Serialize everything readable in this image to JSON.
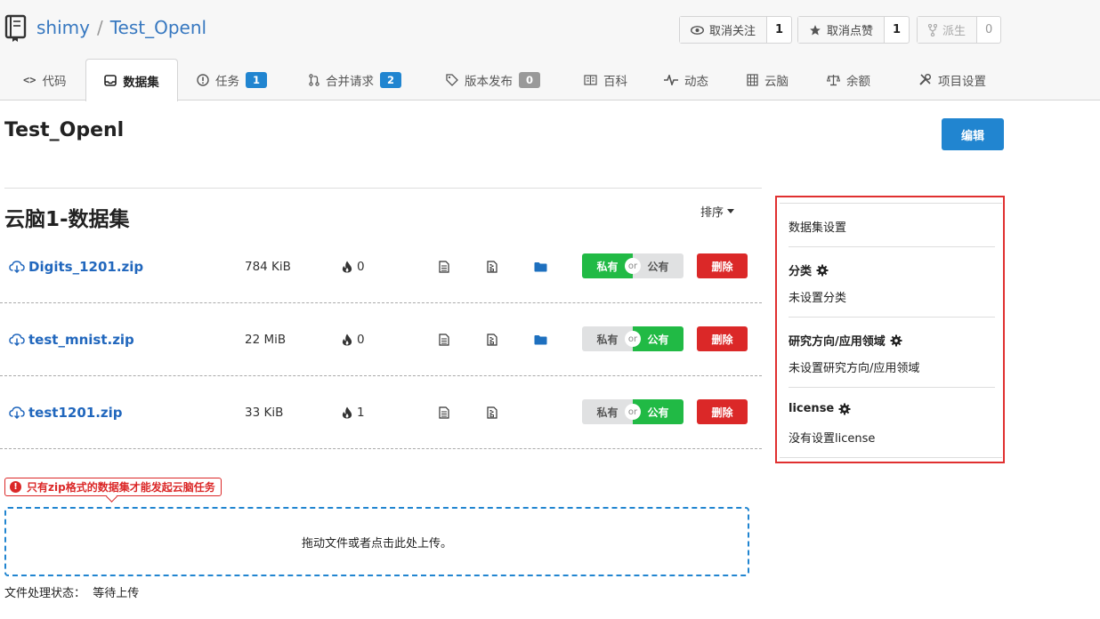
{
  "repo": {
    "owner": "shimy",
    "separator": "/",
    "name": "Test_Openl"
  },
  "actions": [
    {
      "label": "取消关注",
      "count": "1",
      "icon": "eye-icon"
    },
    {
      "label": "取消点赞",
      "count": "1",
      "icon": "star-icon"
    },
    {
      "label": "派生",
      "count": "0",
      "icon": "fork-icon",
      "disabled": true
    }
  ],
  "tabs": [
    {
      "label": "代码",
      "icon": "code-icon"
    },
    {
      "label": "数据集",
      "icon": "inbox-icon",
      "active": true
    },
    {
      "label": "任务",
      "icon": "info-circle-icon",
      "badge": "1"
    },
    {
      "label": "合并请求",
      "icon": "pull-request-icon",
      "badge": "2"
    },
    {
      "label": "版本发布",
      "icon": "tag-icon",
      "badge": "0"
    },
    {
      "label": "百科",
      "icon": "book-icon"
    },
    {
      "label": "动态",
      "icon": "pulse-icon"
    },
    {
      "label": "云脑",
      "icon": "server-icon"
    },
    {
      "label": "余额",
      "icon": "balance-scale-icon"
    },
    {
      "label": "项目设置",
      "icon": "tools-icon"
    }
  ],
  "page": {
    "title": "Test_Openl",
    "edit_label": "编辑"
  },
  "dataset": {
    "title": "云脑1-数据集",
    "sort_label": "排序",
    "files": [
      {
        "name": "Digits_1201.zip",
        "size": "784 KiB",
        "hot": "0",
        "folder": true,
        "public": false
      },
      {
        "name": "test_mnist.zip",
        "size": "22 MiB",
        "hot": "0",
        "folder": true,
        "public": true
      },
      {
        "name": "test1201.zip",
        "size": "33 KiB",
        "hot": "1",
        "folder": false,
        "public": true
      }
    ],
    "toggle": {
      "private": "私有",
      "or": "or",
      "public": "公有"
    },
    "delete_label": "删除"
  },
  "sidebar": {
    "settings_label": "数据集设置",
    "category": {
      "label": "分类",
      "value": "未设置分类"
    },
    "research": {
      "label": "研究方向/应用领域",
      "value": "未设置研究方向/应用领域"
    },
    "license": {
      "label": "license",
      "value": "没有设置license"
    }
  },
  "upload": {
    "warning": "只有zip格式的数据集才能发起云脑任务",
    "dropzone": "拖动文件或者点击此处上传。",
    "status_label": "文件处理状态：",
    "status_value": "等待上传"
  },
  "colors": {
    "accent": "#2185d0",
    "success": "#21ba45",
    "danger": "#db2828",
    "link": "#2167bd",
    "highlight": "#e03030"
  }
}
